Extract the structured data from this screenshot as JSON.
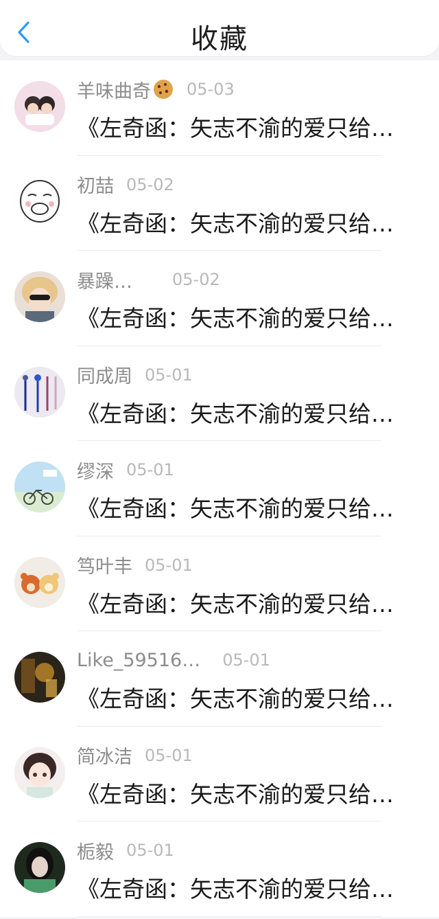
{
  "header": {
    "title": "收藏",
    "back_icon": "chevron-left-icon"
  },
  "colors": {
    "accent": "#2b9cf2",
    "name": "#8c8c8c",
    "date": "#b8b8b8",
    "text": "#1a1a1a"
  },
  "items": [
    {
      "name": "羊味曲奇",
      "emoji": "cookie-icon",
      "date": "05-03",
      "text": "《左奇函：矢志不渝的爱只给…"
    },
    {
      "name": "初喆",
      "date": "05-02",
      "text": "《左奇函：矢志不渝的爱只给…"
    },
    {
      "name": "暴躁…",
      "date": "05-02",
      "text": "《左奇函：矢志不渝的爱只给…"
    },
    {
      "name": "同成周",
      "date": "05-01",
      "text": "《左奇函：矢志不渝的爱只给…"
    },
    {
      "name": "缪深",
      "date": "05-01",
      "text": "《左奇函：矢志不渝的爱只给…"
    },
    {
      "name": "笃叶丰",
      "date": "05-01",
      "text": "《左奇函：矢志不渝的爱只给…"
    },
    {
      "name": "Like_59516…",
      "date": "05-01",
      "text": "《左奇函：矢志不渝的爱只给…"
    },
    {
      "name": "简冰洁",
      "date": "05-01",
      "text": "《左奇函：矢志不渝的爱只给…"
    },
    {
      "name": "栀毅",
      "date": "05-01",
      "text": "《左奇函：矢志不渝的爱只给…"
    }
  ]
}
